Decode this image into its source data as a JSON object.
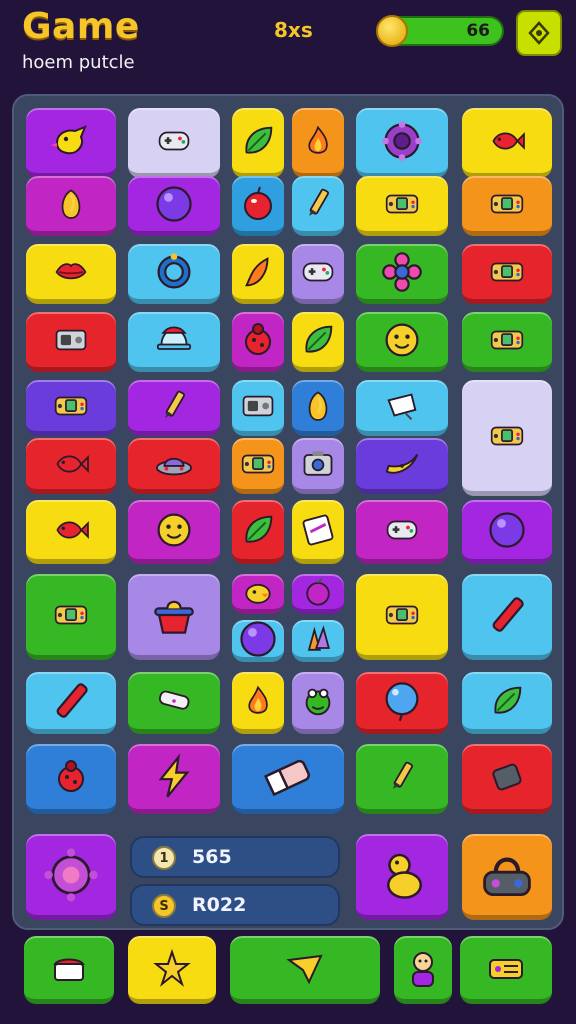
{
  "header": {
    "title": "Game",
    "subtitle": "hoem putcle",
    "level": "8xs",
    "coins": "66"
  },
  "colors": {
    "purple": "#a326e0",
    "lavender": "#d7d2f3",
    "yellow": "#f6dc10",
    "orange": "#f4941a",
    "cyan": "#4fc4ef",
    "blue": "#2f7fd8",
    "red": "#e6242b",
    "green": "#35b824",
    "magenta": "#c126c4",
    "violet": "#6a3cdc"
  },
  "tiles": [
    {
      "icon": "bird-icon",
      "color": "#a326e0"
    },
    {
      "icon": "gamepad-icon",
      "color": "#d7d2f3"
    },
    {
      "icon": "leaf-icon",
      "color": "#f6dc10"
    },
    {
      "icon": "flame-icon",
      "color": "#f4941a"
    },
    {
      "icon": "gear-icon",
      "color": "#4fc4ef"
    },
    {
      "icon": "fish-icon",
      "color": "#f6dc10"
    },
    {
      "icon": "gem-icon",
      "color": "#c126c4"
    },
    {
      "icon": "orb-icon",
      "color": "#a326e0"
    },
    {
      "icon": "apple-icon",
      "color": "#2f9fe0"
    },
    {
      "icon": "pencil-icon",
      "color": "#4fc4ef"
    },
    {
      "icon": "handheld-console-icon",
      "color": "#f6dc10"
    },
    {
      "icon": "handheld-console-icon",
      "color": "#f4941a"
    },
    {
      "icon": "lips-icon",
      "color": "#f6dc10"
    },
    {
      "icon": "ring-icon",
      "color": "#4fc4ef"
    },
    {
      "icon": "pepper-icon",
      "color": "#f6dc10"
    },
    {
      "icon": "gamepad-icon",
      "color": "#a888e6"
    },
    {
      "icon": "flower-icon",
      "color": "#35b824"
    },
    {
      "icon": "handheld-console-icon",
      "color": "#e6242b"
    },
    {
      "icon": "radio-icon",
      "color": "#e6242b"
    },
    {
      "icon": "hat-icon",
      "color": "#4fc4ef"
    },
    {
      "icon": "bug-icon",
      "color": "#c126c4"
    },
    {
      "icon": "leaf-icon",
      "color": "#f6dc10"
    },
    {
      "icon": "face-icon",
      "color": "#35b824"
    },
    {
      "icon": "handheld-console-icon",
      "color": "#35b824"
    },
    {
      "icon": "handheld-console-icon",
      "color": "#6a3cdc"
    },
    {
      "icon": "pencil-icon",
      "color": "#a326e0"
    },
    {
      "icon": "radio-icon",
      "color": "#4fc4ef"
    },
    {
      "icon": "gem-icon",
      "color": "#2f7fd8"
    },
    {
      "icon": "note-icon",
      "color": "#4fc4ef"
    },
    {
      "icon": "handheld-console-icon",
      "color": "#d7d2f3"
    },
    {
      "icon": "fish-icon",
      "color": "#e6242b"
    },
    {
      "icon": "ufo-icon",
      "color": "#e6242b"
    },
    {
      "icon": "handheld-console-icon",
      "color": "#f4941a"
    },
    {
      "icon": "camera-icon",
      "color": "#a888e6"
    },
    {
      "icon": "banana-icon",
      "color": "#6a3cdc"
    },
    {
      "icon": "fish-icon",
      "color": "#f6dc10"
    },
    {
      "icon": "face-icon",
      "color": "#c126c4"
    },
    {
      "icon": "leaf-icon",
      "color": "#e6242b"
    },
    {
      "icon": "card-icon",
      "color": "#f6dc10"
    },
    {
      "icon": "gamepad-icon",
      "color": "#c126c4"
    },
    {
      "icon": "orb-icon",
      "color": "#a326e0"
    },
    {
      "icon": "handheld-console-icon",
      "color": "#35b824"
    },
    {
      "icon": "pot-icon",
      "color": "#a888e6"
    },
    {
      "icon": "duck-icon",
      "color": "#c126c4"
    },
    {
      "icon": "orb-icon",
      "color": "#4fc4ef"
    },
    {
      "icon": "plum-icon",
      "color": "#a326e0"
    },
    {
      "icon": "crystal-icon",
      "color": "#4fc4ef"
    },
    {
      "icon": "handheld-console-icon",
      "color": "#f6dc10"
    },
    {
      "icon": "marker-icon",
      "color": "#4fc4ef"
    },
    {
      "icon": "marker-icon",
      "color": "#4fc4ef"
    },
    {
      "icon": "bandage-icon",
      "color": "#35b824"
    },
    {
      "icon": "flame-icon",
      "color": "#f6dc10"
    },
    {
      "icon": "frog-icon",
      "color": "#a888e6"
    },
    {
      "icon": "balloon-icon",
      "color": "#e6242b"
    },
    {
      "icon": "leaf-icon",
      "color": "#4fc4ef"
    },
    {
      "icon": "bug-icon",
      "color": "#2f7fd8"
    },
    {
      "icon": "lightning-icon",
      "color": "#c126c4"
    },
    {
      "icon": "eraser-icon",
      "color": "#2f7fd8"
    },
    {
      "icon": "pencil-icon",
      "color": "#35b824"
    },
    {
      "icon": "phone-icon",
      "color": "#e6242b"
    },
    {
      "icon": "virus-icon",
      "color": "#a326e0"
    },
    {
      "icon": "gourd-icon",
      "color": "#a326e0"
    },
    {
      "icon": "lock-icon",
      "color": "#f4941a"
    }
  ],
  "scores": [
    {
      "icon_text": "1",
      "value": "565"
    },
    {
      "icon_text": "S",
      "value": "R022"
    }
  ],
  "footer": [
    {
      "name": "cake-button",
      "icon": "cake-icon",
      "color": "#35b824"
    },
    {
      "name": "star-button",
      "icon": "star-icon",
      "color": "#f6dc10"
    },
    {
      "name": "play-button",
      "icon": "send-icon",
      "color": "#35b824"
    },
    {
      "name": "character-button",
      "icon": "character-icon",
      "color": "#35b824"
    },
    {
      "name": "ticket-button",
      "icon": "ticket-icon",
      "color": "#35b824"
    }
  ]
}
